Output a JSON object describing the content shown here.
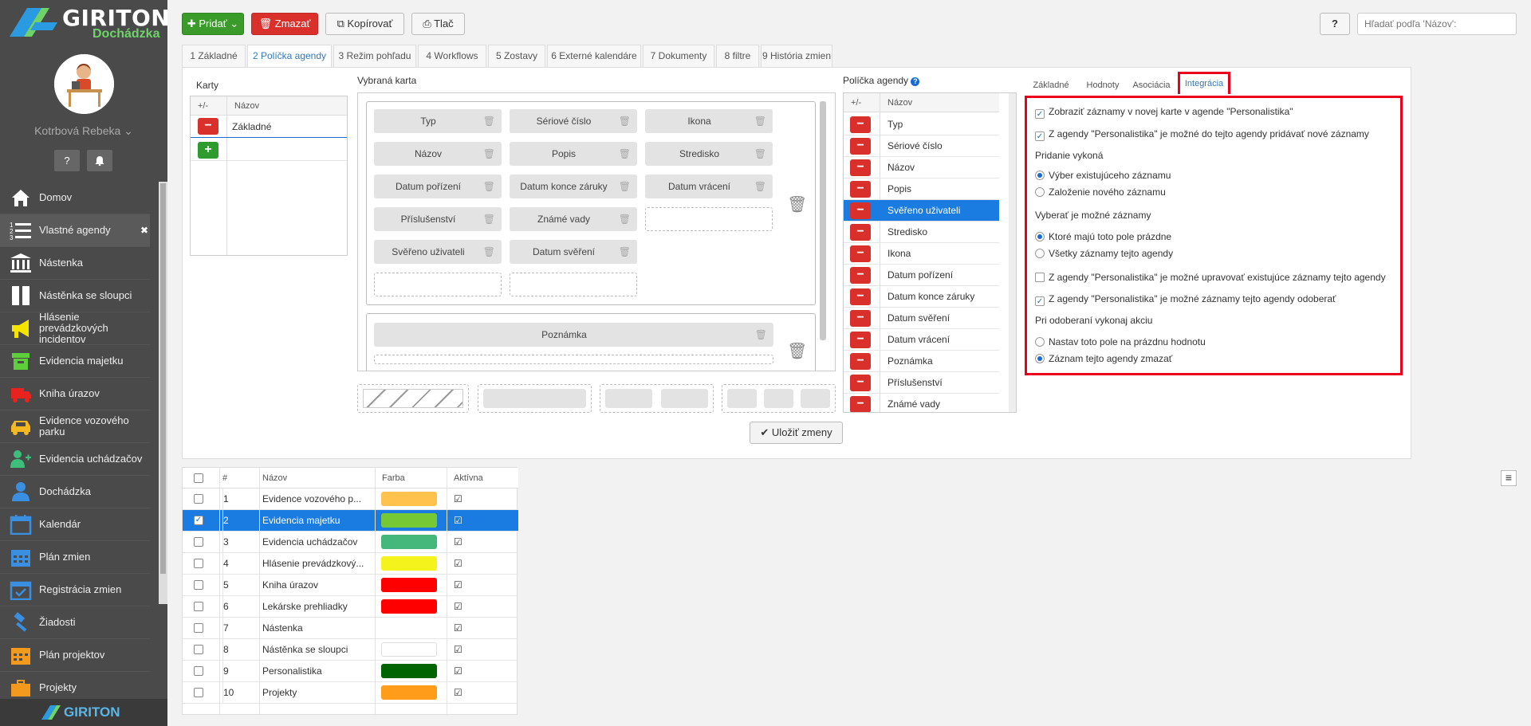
{
  "app": {
    "brand": "GIRITON",
    "module": "Dochádzka",
    "user": "Kotrbová Rebeka",
    "help_btn": "?",
    "footer_brand": "GIRITON"
  },
  "menu": [
    {
      "label": "Domov",
      "icon": "home-icon"
    },
    {
      "label": "Vlastné agendy",
      "icon": "list-icon",
      "active": true,
      "close": "✖"
    },
    {
      "label": "Nástenka",
      "icon": "bank-icon"
    },
    {
      "label": "Nástěnka se sloupci",
      "icon": "columns-icon"
    },
    {
      "label": "Hlásenie prevádzkových incidentov",
      "icon": "megaphone-icon"
    },
    {
      "label": "Evidencia majetku",
      "icon": "box-icon"
    },
    {
      "label": "Kniha úrazov",
      "icon": "ambulance-icon"
    },
    {
      "label": "Evidence vozového parku",
      "icon": "car-icon"
    },
    {
      "label": "Evidencia uchádzačov",
      "icon": "user-plus-icon"
    },
    {
      "label": "Dochádzka",
      "icon": "user-icon"
    },
    {
      "label": "Kalendár",
      "icon": "calendar-icon"
    },
    {
      "label": "Plán zmien",
      "icon": "calendar-grid-icon"
    },
    {
      "label": "Registrácia zmien",
      "icon": "calendar-check-icon"
    },
    {
      "label": "Žiadosti",
      "icon": "gavel-icon"
    },
    {
      "label": "Plán projektov",
      "icon": "calendar-orange-icon"
    },
    {
      "label": "Projekty",
      "icon": "briefcase-icon"
    }
  ],
  "toolbar": {
    "add": "Pridať",
    "delete": "Zmazať",
    "copy": "Kopírovať",
    "print": "Tlač",
    "help": "?",
    "search_placeholder": "Hľadať podľa 'Názov':"
  },
  "tabs": [
    "1 Základné",
    "2 Políčka agendy",
    "3 Režim pohľadu",
    "4 Workflows",
    "5 Zostavy",
    "6 Externé kalendáre",
    "7 Dokumenty",
    "8 filtre",
    "9 História zmien"
  ],
  "karty": {
    "title": "Karty",
    "col_pm": "+/-",
    "col_name": "Názov",
    "rows": [
      "Základné"
    ]
  },
  "vybrana_karta": {
    "title": "Vybraná karta",
    "fields": [
      "Typ",
      "Sériové číslo",
      "Ikona",
      "Názov",
      "Popis",
      "Stredisko",
      "Datum pořízení",
      "Datum konce záruky",
      "Datum vrácení",
      "Příslušenství",
      "Známé vady",
      "Svěřeno uživateli",
      "Datum svěření"
    ],
    "note_field": "Poznámka",
    "save": "Uložiť zmeny"
  },
  "policka": {
    "title": "Políčka agendy",
    "col_pm": "+/-",
    "col_name": "Názov",
    "rows": [
      "Typ",
      "Sériové číslo",
      "Názov",
      "Popis",
      "Svěřeno uživateli",
      "Stredisko",
      "Ikona",
      "Datum pořízení",
      "Datum konce záruky",
      "Datum svěření",
      "Datum vrácení",
      "Poznámka",
      "Příslušenství",
      "Známé vady"
    ],
    "selected": "Svěřeno uživateli"
  },
  "integracia": {
    "tabs": [
      "Základné",
      "Hodnoty",
      "Asociácia",
      "Integrácia"
    ],
    "active_tab": "Integrácia",
    "cb1": "Zobraziť záznamy v novej karte v agende \"Personalistika\"",
    "cb2": "Z agendy \"Personalistika\" je možné do tejto agendy pridávať nové záznamy",
    "sec1": "Pridanie vykoná",
    "r1a": "Výber existujúceho záznamu",
    "r1b": "Založenie nového záznamu",
    "sec2": "Vyberať je možné záznamy",
    "r2a": "Ktoré majú toto pole prázdne",
    "r2b": "Všetky záznamy tejto agendy",
    "cb3": "Z agendy \"Personalistika\" je možné upravovať existujúce záznamy tejto agendy",
    "cb4": "Z agendy \"Personalistika\" je možné záznamy tejto agendy odoberať",
    "sec3": "Pri odoberaní vykonaj akciu",
    "r3a": "Nastav toto pole na prázdnu hodnotu",
    "r3b": "Záznam tejto agendy zmazať"
  },
  "table": {
    "headers": [
      "#",
      "Názov",
      "Farba",
      "Aktívna"
    ],
    "rows": [
      {
        "n": "1",
        "name": "Evidence vozového p...",
        "color": "#ffc34d"
      },
      {
        "n": "2",
        "name": "Evidencia majetku",
        "color": "#76c934",
        "sel": true
      },
      {
        "n": "3",
        "name": "Evidencia uchádzačov",
        "color": "#44b87a"
      },
      {
        "n": "4",
        "name": "Hlásenie prevádzkový...",
        "color": "#f4f31c"
      },
      {
        "n": "5",
        "name": "Kniha úrazov",
        "color": "#ff0000"
      },
      {
        "n": "6",
        "name": "Lekárske prehliadky",
        "color": "#ff0000"
      },
      {
        "n": "7",
        "name": "Nástenka",
        "color": ""
      },
      {
        "n": "8",
        "name": "Nástěnka se sloupci",
        "color": "#ffffff"
      },
      {
        "n": "9",
        "name": "Personalistika",
        "color": "#006400"
      },
      {
        "n": "10",
        "name": "Projekty",
        "color": "#ff9c1a"
      }
    ]
  }
}
